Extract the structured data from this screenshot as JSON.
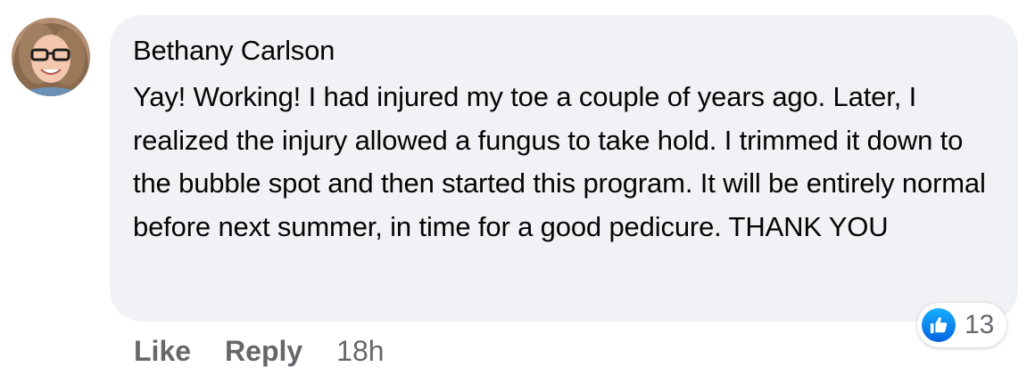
{
  "comment": {
    "author": "Bethany Carlson",
    "text": "Yay! Working! I had injured my toe a couple of years ago. Later, I realized the injury allowed a fungus to take hold. I trimmed it down to the bubble spot and then started this program. It will be entirely normal before next summer, in time for a good pedicure. THANK YOU",
    "reactions": {
      "icon": "thumbs-up-icon",
      "count": "13"
    },
    "actions": {
      "like_label": "Like",
      "reply_label": "Reply",
      "timestamp": "18h"
    }
  },
  "colors": {
    "bubble": "#f0f2f5",
    "secondary_text": "#65676b",
    "like_blue": "#0866ff"
  }
}
